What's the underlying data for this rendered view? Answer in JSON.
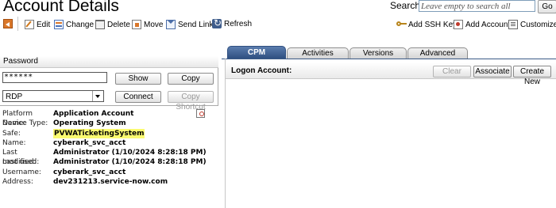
{
  "header": {
    "title": "Account Details",
    "search_label": "Search:",
    "search_placeholder": "Leave empty to search all",
    "go_label": "Go"
  },
  "toolbar": {
    "edit": "Edit",
    "change": "Change",
    "delete": "Delete",
    "move": "Move",
    "send_link": "Send Link",
    "refresh": "Refresh",
    "add_ssh_key": "Add SSH Key",
    "add_account": "Add Account",
    "customize": "Customize"
  },
  "password_panel": {
    "label": "Password",
    "value": "******",
    "show": "Show",
    "copy": "Copy",
    "connection_type": "RDP",
    "connect": "Connect",
    "copy_shortcut": "Copy Shortcut"
  },
  "properties": {
    "platform_name": {
      "label": "Platform Name:",
      "value": "Application Account"
    },
    "device_type": {
      "label": "Device Type:",
      "value": "Operating System"
    },
    "safe": {
      "label": "Safe:",
      "value": "PVWATicketingSystem"
    },
    "name": {
      "label": "Name:",
      "value": "cyberark_svc_acct"
    },
    "last_modified": {
      "label": "Last modified:",
      "value": "Administrator (1/10/2024 8:28:18 PM)"
    },
    "last_used": {
      "label": "Last used:",
      "value": "Administrator (1/10/2024 8:28:18 PM)"
    },
    "username": {
      "label": "Username:",
      "value": "cyberark_svc_acct"
    },
    "address": {
      "label": "Address:",
      "value": "dev231213.service-now.com"
    }
  },
  "tabs": {
    "cpm": "CPM",
    "activities": "Activities",
    "versions": "Versions",
    "advanced": "Advanced"
  },
  "cpm_panel": {
    "logon_account_label": "Logon Account:",
    "clear": "Clear",
    "associate": "Associate",
    "create_new": "Create New"
  }
}
